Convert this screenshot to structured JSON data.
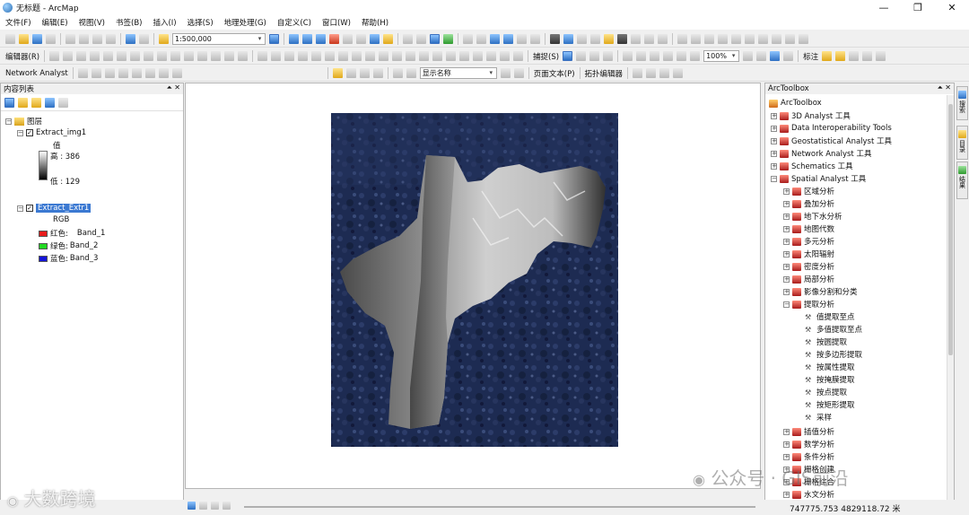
{
  "window": {
    "title": "无标题 - ArcMap"
  },
  "menu": [
    "文件(F)",
    "编辑(E)",
    "视图(V)",
    "书签(B)",
    "插入(I)",
    "选择(S)",
    "地理处理(G)",
    "自定义(C)",
    "窗口(W)",
    "帮助(H)"
  ],
  "toolbar1": {
    "scale": "1:500,000"
  },
  "toolbar2": {
    "editor": "编辑器(R)",
    "snapping": "捕捉(S)",
    "zoom": "100%",
    "label": "标注"
  },
  "toolbar3": {
    "network": "Network Analyst",
    "display_name": "显示名称",
    "layout_text": "页面文本(P)",
    "topology": "拓扑编辑器"
  },
  "toc": {
    "title": "内容列表",
    "layers_label": "图层",
    "layer1": {
      "name": "Extract_img1",
      "value_label": "值",
      "high": "高 : 386",
      "low": "低 : 129"
    },
    "layer2": {
      "name": "Extract_Extr1",
      "rgb": "RGB",
      "bands": [
        {
          "channel": "红色:",
          "band": "Band_1",
          "color": "#e81c1c"
        },
        {
          "channel": "绿色:",
          "band": "Band_2",
          "color": "#22d922"
        },
        {
          "channel": "蓝色:",
          "band": "Band_3",
          "color": "#1414d8"
        }
      ]
    }
  },
  "toolbox": {
    "title": "ArcToolbox",
    "root": "ArcToolbox",
    "toolsets": [
      "3D Analyst 工具",
      "Data Interoperability Tools",
      "Geostatistical Analyst 工具",
      "Network Analyst 工具",
      "Schematics 工具",
      "Spatial Analyst 工具"
    ],
    "spatial_children": [
      "区域分析",
      "叠加分析",
      "地下水分析",
      "地图代数",
      "多元分析",
      "太阳辐射",
      "密度分析",
      "局部分析",
      "影像分割和分类",
      "提取分析"
    ],
    "extract_tools": [
      "值提取至点",
      "多值提取至点",
      "按圆提取",
      "按多边形提取",
      "按属性提取",
      "按掩膜提取",
      "按点提取",
      "按矩形提取",
      "采样"
    ],
    "more_children": [
      "插值分析",
      "数学分析",
      "条件分析",
      "栅格创建",
      "栅格综合",
      "水文分析"
    ]
  },
  "side_tabs": [
    "搜索",
    "目录",
    "结果"
  ],
  "status": {
    "coords": "747775.753  4829118.72 米"
  },
  "watermarks": {
    "left": "大数跨境",
    "right": "公众号 · GIS前沿"
  }
}
